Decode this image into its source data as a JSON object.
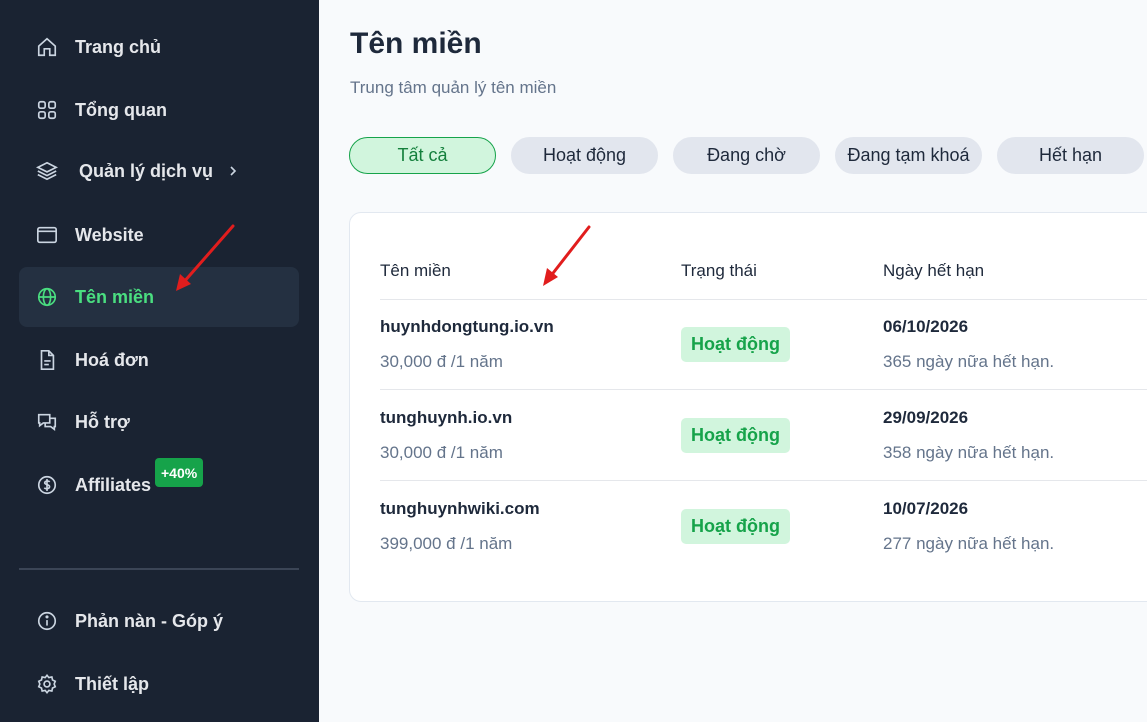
{
  "sidebar": {
    "items": [
      {
        "label": "Trang chủ"
      },
      {
        "label": "Tổng quan"
      },
      {
        "label": "Quản lý dịch vụ"
      },
      {
        "label": "Website"
      },
      {
        "label": "Tên miền"
      },
      {
        "label": "Hoá đơn"
      },
      {
        "label": "Hỗ trợ"
      },
      {
        "label": "Affiliates"
      }
    ],
    "affiliates_badge": "+40%",
    "bottom_items": [
      {
        "label": "Phản nàn - Góp ý"
      },
      {
        "label": "Thiết lập"
      }
    ]
  },
  "main": {
    "title": "Tên miền",
    "subtitle": "Trung tâm quản lý tên miền",
    "filters": [
      {
        "label": "Tất cả"
      },
      {
        "label": "Hoạt động"
      },
      {
        "label": "Đang chờ"
      },
      {
        "label": "Đang tạm khoá"
      },
      {
        "label": "Hết hạn"
      }
    ],
    "table": {
      "headers": [
        "Tên miền",
        "Trạng thái",
        "Ngày hết hạn"
      ],
      "rows": [
        {
          "domain": "huynhdongtung.io.vn",
          "price": "30,000 đ /1 năm",
          "status": "Hoạt động",
          "expiry": "06/10/2026",
          "remaining": "365 ngày nữa hết hạn."
        },
        {
          "domain": "tunghuynh.io.vn",
          "price": "30,000 đ /1 năm",
          "status": "Hoạt động",
          "expiry": "29/09/2026",
          "remaining": "358 ngày nữa hết hạn."
        },
        {
          "domain": "tunghuynhwiki.com",
          "price": "399,000 đ /1 năm",
          "status": "Hoạt động",
          "expiry": "10/07/2026",
          "remaining": "277 ngày nữa hết hạn."
        }
      ]
    }
  },
  "colors": {
    "sidebar_bg": "#1a2332",
    "accent_green": "#16a34a",
    "annotation_arrow": "#e11d1d"
  }
}
